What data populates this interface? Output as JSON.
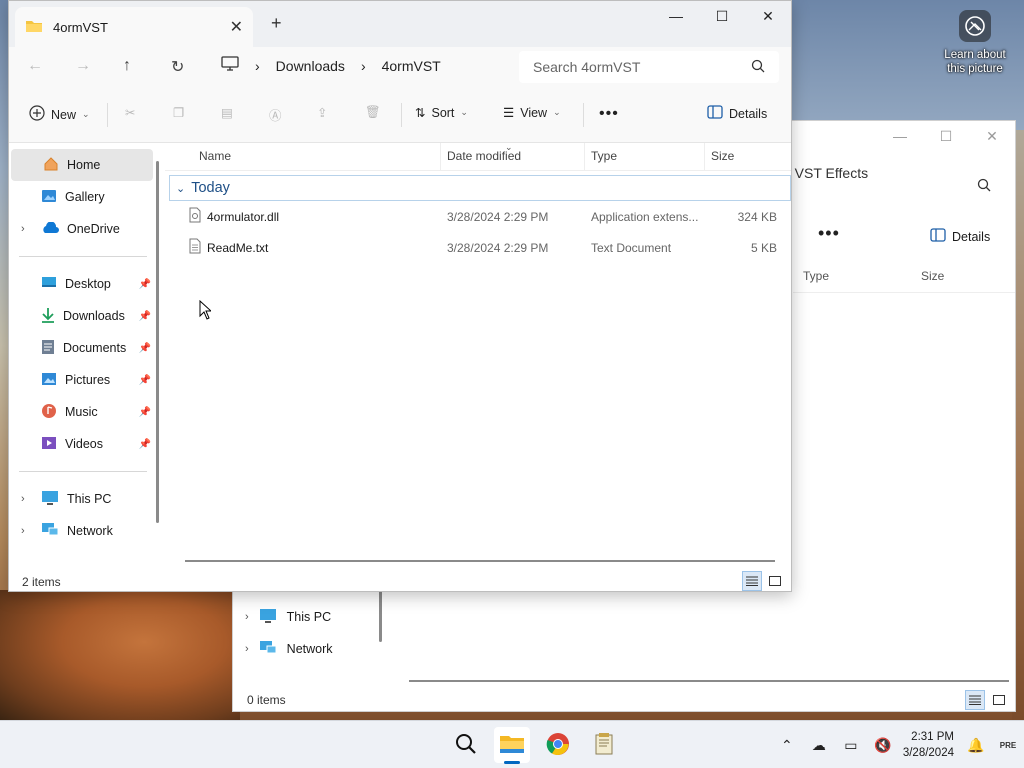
{
  "desktop": {
    "learn_line1": "Learn about",
    "learn_line2": "this picture"
  },
  "back_window": {
    "address_partial": "n VST Effects",
    "toolbar_more": "•••",
    "details_label": "Details",
    "columns": [
      "Type",
      "Size"
    ],
    "nav": [
      {
        "label": "This PC",
        "icon": "computer-icon"
      },
      {
        "label": "Network",
        "icon": "network-icon"
      }
    ],
    "status": "0 items"
  },
  "window": {
    "tab_title": "4ormVST",
    "tab_close": "✕",
    "new_tab": "+",
    "controls": {
      "minimize": "—",
      "maximize": "☐",
      "close": "✕"
    },
    "breadcrumb": [
      "Downloads",
      "4ormVST"
    ],
    "search_placeholder": "Search 4ormVST",
    "toolbar": {
      "new": "New",
      "sort": "Sort",
      "view": "View",
      "more": "•••",
      "details": "Details"
    },
    "sidebar": {
      "home": "Home",
      "gallery": "Gallery",
      "onedrive": "OneDrive",
      "quick": [
        {
          "label": "Desktop",
          "icon": "desktop-icon"
        },
        {
          "label": "Downloads",
          "icon": "downloads-icon"
        },
        {
          "label": "Documents",
          "icon": "documents-icon"
        },
        {
          "label": "Pictures",
          "icon": "pictures-icon"
        },
        {
          "label": "Music",
          "icon": "music-icon"
        },
        {
          "label": "Videos",
          "icon": "videos-icon"
        }
      ],
      "this_pc": "This PC",
      "network": "Network"
    },
    "columns": {
      "name": "Name",
      "date": "Date modified",
      "type": "Type",
      "size": "Size"
    },
    "group": "Today",
    "files": [
      {
        "name": "4ormulator.dll",
        "date": "3/28/2024 2:29 PM",
        "type": "Application extens...",
        "size": "324 KB",
        "icon": "dll-file-icon"
      },
      {
        "name": "ReadMe.txt",
        "date": "3/28/2024 2:29 PM",
        "type": "Text Document",
        "size": "5 KB",
        "icon": "text-file-icon"
      }
    ],
    "status": "2 items"
  },
  "taskbar": {
    "time": "2:31 PM",
    "date": "3/28/2024",
    "apps": [
      "search-icon",
      "file-explorer-icon",
      "chrome-icon",
      "notepad-icon"
    ]
  },
  "colors": {
    "accent": "#0067c0",
    "folder": "#f4c542",
    "group_text": "#1e4f86"
  }
}
